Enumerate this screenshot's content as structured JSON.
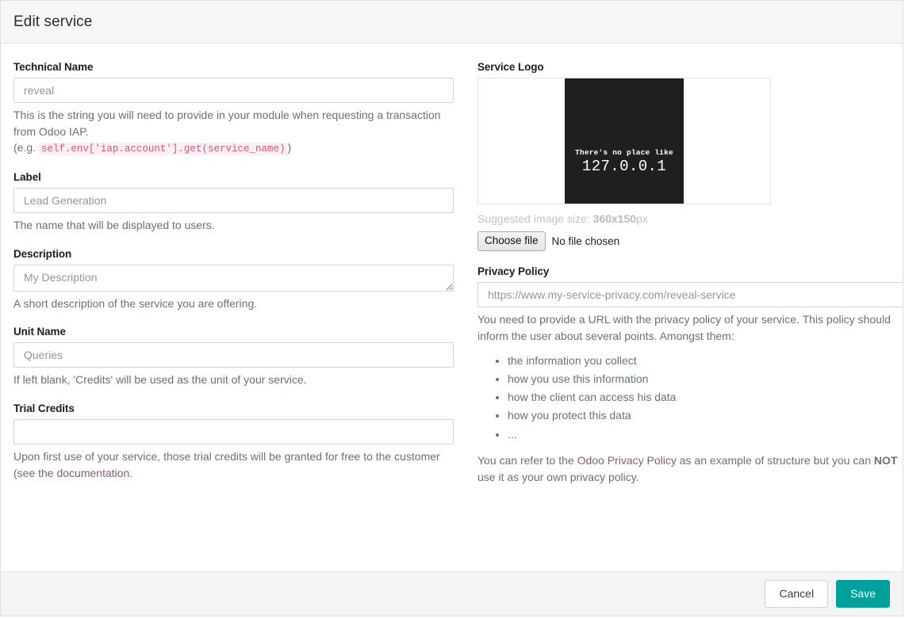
{
  "header": {
    "title": "Edit service"
  },
  "form": {
    "technical_name": {
      "label": "Technical Name",
      "value": "",
      "placeholder": "reveal",
      "help_line1": "This is the string you will need to provide in your module when requesting a transaction from Odoo IAP.",
      "help_prefix": "(e.g.",
      "help_code": "self.env['iap.account'].get(service_name)",
      "help_suffix": ")"
    },
    "label_field": {
      "label": "Label",
      "value": "",
      "placeholder": "Lead Generation",
      "help": "The name that will be displayed to users."
    },
    "description": {
      "label": "Description",
      "value": "",
      "placeholder": "My Description",
      "help": "A short description of the service you are offering."
    },
    "unit_name": {
      "label": "Unit Name",
      "value": "",
      "placeholder": "Queries",
      "help": "If left blank, 'Credits' will be used as the unit of your service."
    },
    "trial_credits": {
      "label": "Trial Credits",
      "value": "",
      "placeholder": "",
      "help_before": "Upon first use of your service, those trial credits will be granted for free to the customer (see ",
      "help_link": "the documentation",
      "help_after": "."
    },
    "service_logo": {
      "label": "Service Logo",
      "image_line1": "There's no place like",
      "image_line2": "127.0.0.1",
      "suggested_prefix": "Suggested image size: ",
      "suggested_size": "360x150",
      "suggested_suffix": "px",
      "choose_file_label": "Choose file",
      "no_file_label": "No file chosen"
    },
    "privacy_policy": {
      "label": "Privacy Policy",
      "value": "",
      "placeholder": "https://www.my-service-privacy.com/reveal-service",
      "help_intro": "You need to provide a URL with the privacy policy of your service. This policy should inform the user about several points. Amongst them:",
      "points": [
        "the information you collect",
        "how you use this information",
        "how the client can access his data",
        "how you protect this data",
        "..."
      ],
      "footer_before": "You can refer to the ",
      "footer_link": "Odoo Privacy Policy",
      "footer_middle": " as an example of structure but you can ",
      "footer_bold": "NOT",
      "footer_after": " use it as your own privacy policy."
    }
  },
  "footer": {
    "cancel_label": "Cancel",
    "save_label": "Save"
  },
  "colors": {
    "primary": "#00A09D",
    "link": "#875A7B",
    "code": "#d6557f",
    "muted": "#69707a"
  }
}
